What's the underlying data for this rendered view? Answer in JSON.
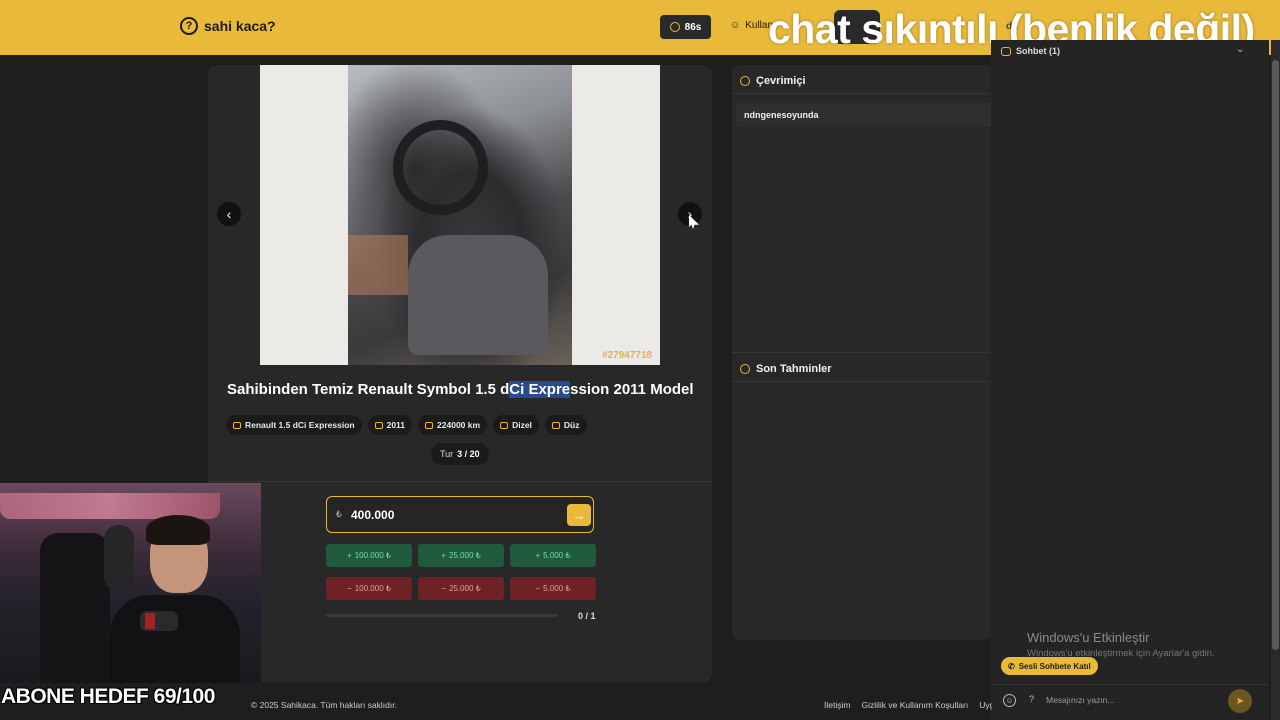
{
  "header": {
    "logo_text": "sahi kaca?",
    "timer": "86s",
    "users_link": "Kullanı",
    "partial_text": "da",
    "accent_color": "#e9b93a"
  },
  "stream_overlay": {
    "title": "chat sıkıntılı (benlik değil)",
    "sub_goal": "ABONE HEDEF 69/100"
  },
  "game": {
    "image_id": "#27947718",
    "title_before": "Sahibinden Temiz Renault Symbol 1.5 d",
    "title_highlight": "Ci Expre",
    "title_after": "ssion 2011 Model",
    "tags": [
      {
        "icon": "car-icon",
        "label": "Renault 1.5 dCi Expression"
      },
      {
        "icon": "calendar-icon",
        "label": "2011"
      },
      {
        "icon": "gauge-icon",
        "label": "224000 km"
      },
      {
        "icon": "fuel-icon",
        "label": "Dizel"
      },
      {
        "icon": "gear-icon",
        "label": "Düz"
      }
    ],
    "round_label": "Tur",
    "round_value": "3 / 20",
    "currency_symbol": "₺",
    "guess_value": "400.000",
    "plus_buttons": [
      "100.000 ₺",
      "25.000 ₺",
      "5.000 ₺"
    ],
    "minus_buttons": [
      "100.000 ₺",
      "25.000 ₺",
      "5.000 ₺"
    ],
    "progress_fraction": 0,
    "progress_count": "0 / 1"
  },
  "side": {
    "online_title": "Çevrimiçi",
    "online_users": [
      "ndngenesoyunda"
    ],
    "recent_title": "Son Tahminler"
  },
  "chat": {
    "title": "Sohbet (1)",
    "windows_title": "Windows'u Etkinleştir",
    "windows_sub": "Windows'u etkinleştirmek için Ayarlar'a gidin.",
    "voice_button": "Sesli Sohbete Katıl",
    "help": "?",
    "input_placeholder": "Mesajınızı yazın..."
  },
  "footer": {
    "copyright": "© 2025 Sahikaca. Tüm hakları saklıdır.",
    "links": [
      "İletişim",
      "Gizlilik ve Kullanım Koşulları",
      "Uygu"
    ]
  }
}
